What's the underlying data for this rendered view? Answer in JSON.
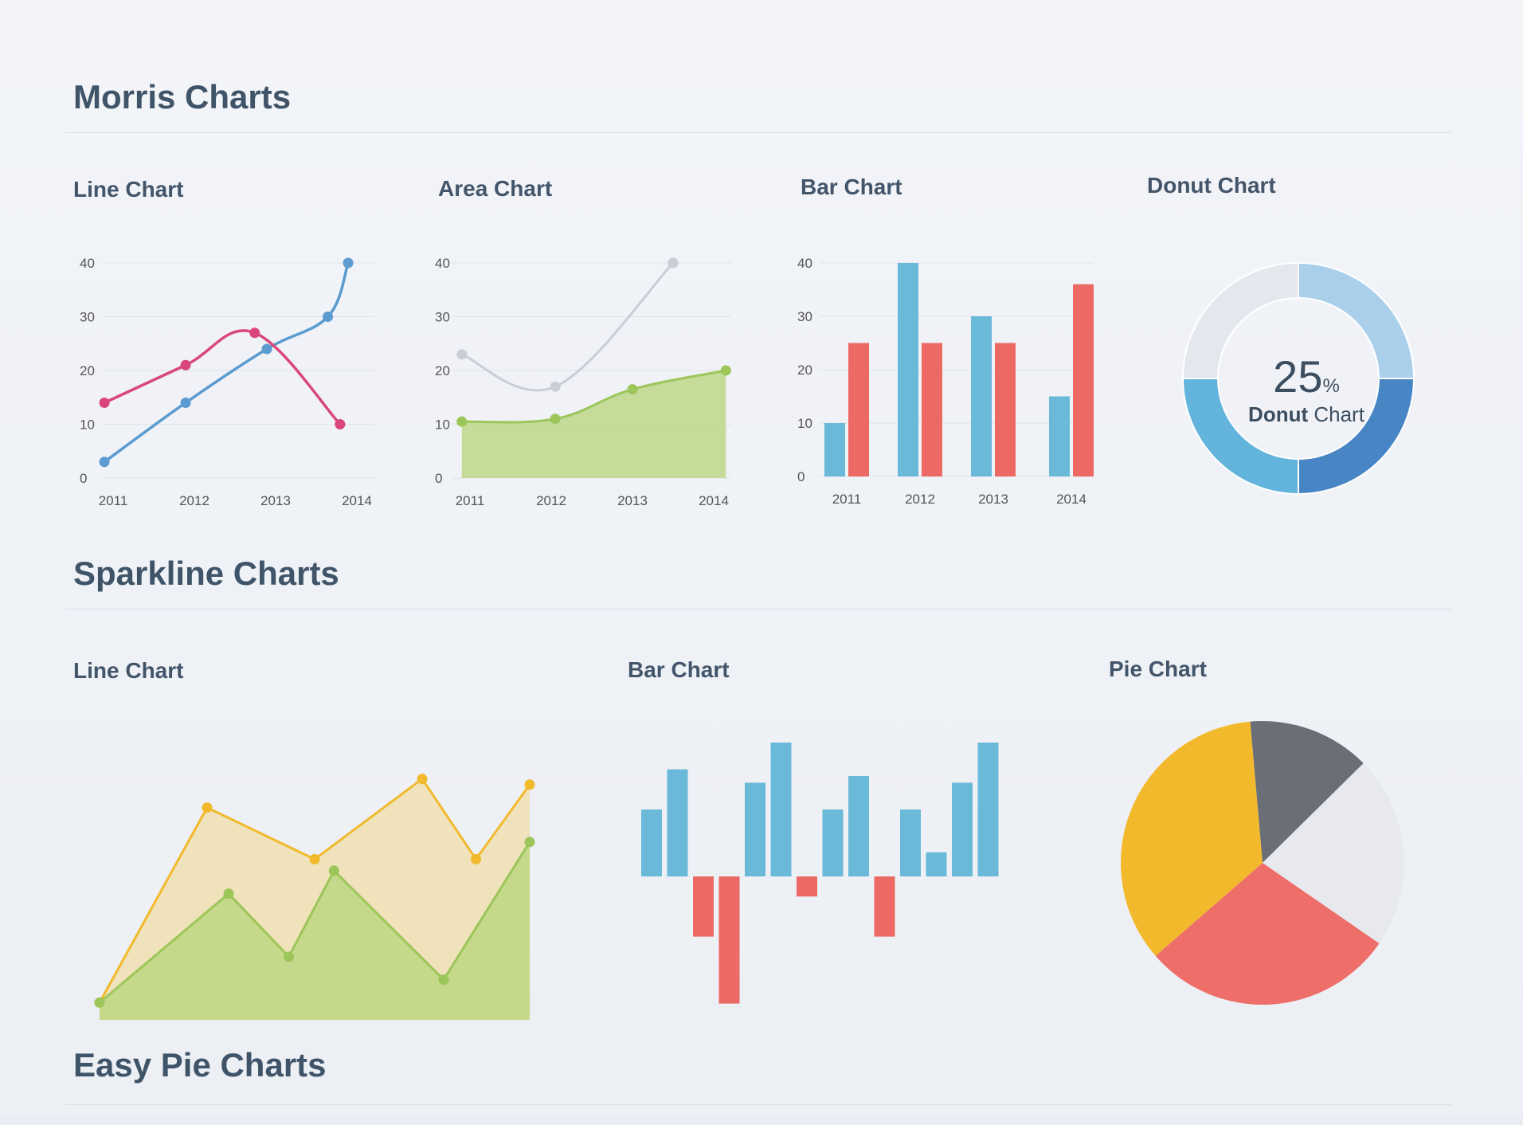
{
  "sections": {
    "morris": "Morris Charts",
    "sparkline": "Sparkline Charts",
    "easy_pie": "Easy Pie Charts"
  },
  "titles": {
    "morris_line": {
      "bold": "Line",
      "rest": " Chart"
    },
    "morris_area": {
      "bold": "Area",
      "rest": " Chart"
    },
    "morris_bar": {
      "bold": "Bar",
      "rest": " Chart"
    },
    "morris_donut": {
      "bold": "Donut",
      "rest": " Chart"
    },
    "spark_line": {
      "bold": "Line",
      "rest": " Chart"
    },
    "spark_bar": {
      "bold": "Bar",
      "rest": " Chart"
    },
    "spark_pie": {
      "bold": "Pie",
      "rest": " Chart"
    }
  },
  "donut_center": {
    "value": "25",
    "unit": "%",
    "bold": "Donut",
    "rest": " Chart"
  },
  "colors": {
    "blue": "#5b9bd0",
    "pink": "#d9477a",
    "gray_line": "#c9ced6",
    "green": "#9cc65a",
    "green_fill": "#bfd88f",
    "bar_blue": "#6ab9d9",
    "bar_red": "#ec6a63",
    "yellow": "#f2b92d",
    "dark_gray": "#6a6e76",
    "light_gray": "#e7e9ee",
    "coral": "#ee6f69",
    "donut_light": "#a9cfeb",
    "donut_dark": "#4785c4",
    "donut_mid": "#62b4dc",
    "donut_track": "#e4e7ed"
  },
  "chart_data": [
    {
      "id": "morris_line",
      "type": "line",
      "categories": [
        "2011",
        "2012",
        "2013",
        "2014"
      ],
      "yticks": [
        0,
        10,
        20,
        30,
        40
      ],
      "ylim": [
        0,
        40
      ],
      "series": [
        {
          "values": [
            3,
            14,
            24,
            40
          ],
          "x": [
            0,
            1,
            2,
            3
          ],
          "extra": [
            {
              "x": 2.75,
              "y": 30
            }
          ],
          "color": "blue"
        },
        {
          "values": [
            14,
            21,
            27,
            10
          ],
          "x": [
            -0.15,
            0.85,
            1.7,
            2.75
          ],
          "color": "pink"
        }
      ]
    },
    {
      "id": "morris_area",
      "type": "area",
      "categories": [
        "2011",
        "2012",
        "2013",
        "2014"
      ],
      "yticks": [
        0,
        10,
        20,
        30,
        40
      ],
      "ylim": [
        0,
        40
      ],
      "series": [
        {
          "points": [
            [
              -0.1,
              23
            ],
            [
              1.05,
              17
            ],
            [
              2.5,
              40
            ]
          ],
          "color": "gray_line"
        },
        {
          "points": [
            [
              -0.1,
              10.5
            ],
            [
              1.05,
              11
            ],
            [
              2.0,
              16.5
            ],
            [
              3.15,
              20
            ]
          ],
          "color": "green"
        }
      ]
    },
    {
      "id": "morris_bar",
      "type": "bar",
      "categories": [
        "2011",
        "2012",
        "2013",
        "2014"
      ],
      "yticks": [
        0,
        10,
        20,
        30,
        40
      ],
      "ylim": [
        0,
        40
      ],
      "series": [
        {
          "values": [
            10,
            40,
            30,
            15
          ],
          "color": "bar_blue"
        },
        {
          "values": [
            25,
            25,
            25,
            36
          ],
          "color": "bar_red"
        }
      ]
    },
    {
      "id": "morris_donut",
      "type": "pie",
      "values": [
        25,
        25,
        25,
        25
      ],
      "colors": [
        "donut_light",
        "donut_dark",
        "donut_mid",
        "donut_track"
      ]
    },
    {
      "id": "spark_line",
      "type": "area",
      "series": [
        {
          "values": [
            3,
            37,
            28,
            42,
            28,
            41
          ],
          "x": [
            0,
            0.25,
            0.5,
            0.75,
            0.875,
            1.0
          ],
          "color": "yellow"
        },
        {
          "values": [
            3,
            22,
            11,
            26,
            7,
            31
          ],
          "x": [
            0,
            0.3,
            0.44,
            0.545,
            0.8,
            1.0
          ],
          "color": "green"
        }
      ],
      "ylim": [
        0,
        50
      ]
    },
    {
      "id": "spark_bar",
      "type": "bar",
      "values": [
        5,
        8,
        -4.5,
        -9.5,
        7,
        10,
        -1.5,
        5,
        7.5,
        -4.5,
        5,
        1.8,
        7,
        10
      ],
      "ylim": [
        -10,
        10
      ]
    },
    {
      "id": "spark_pie",
      "type": "pie",
      "values": [
        14,
        22,
        29,
        35
      ],
      "colors": [
        "dark_gray",
        "light_gray",
        "coral",
        "yellow"
      ],
      "start_angle_deg": 355
    }
  ]
}
